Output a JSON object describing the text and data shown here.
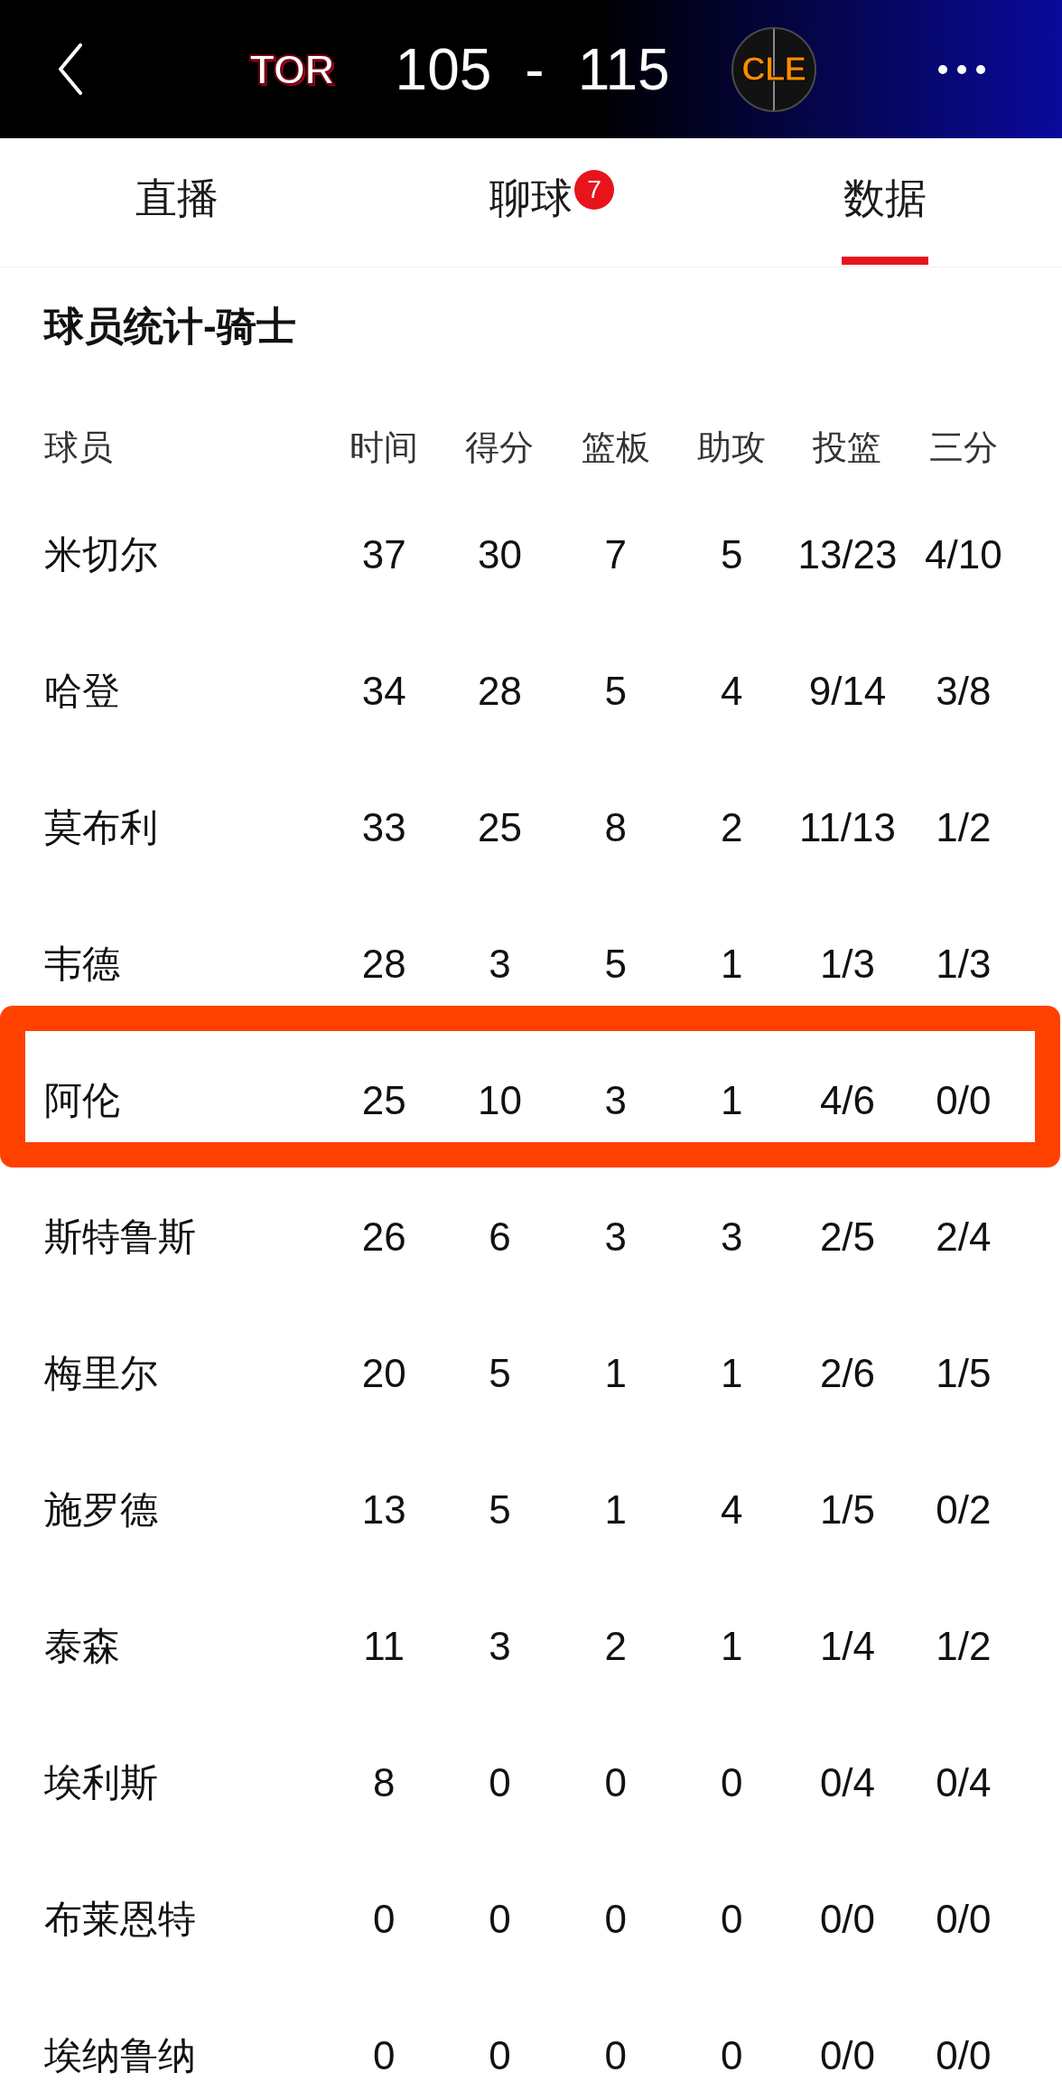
{
  "header": {
    "away_team": {
      "abbr": "TOR"
    },
    "score": "105 - 115",
    "home_team": {
      "abbr": "CLE"
    }
  },
  "tabs": [
    {
      "label": "直播",
      "selected": false
    },
    {
      "label": "聊球",
      "selected": false,
      "badge": "7"
    },
    {
      "label": "数据",
      "selected": true
    }
  ],
  "section_title": "球员统计-骑士",
  "table": {
    "columns": [
      "球员",
      "时间",
      "得分",
      "篮板",
      "助攻",
      "投篮",
      "三分"
    ],
    "rows": [
      {
        "cells": [
          "米切尔",
          "37",
          "30",
          "7",
          "5",
          "13/23",
          "4/10"
        ],
        "highlighted": false
      },
      {
        "cells": [
          "哈登",
          "34",
          "28",
          "5",
          "4",
          "9/14",
          "3/8"
        ],
        "highlighted": false
      },
      {
        "cells": [
          "莫布利",
          "33",
          "25",
          "8",
          "2",
          "11/13",
          "1/2"
        ],
        "highlighted": false
      },
      {
        "cells": [
          "韦德",
          "28",
          "3",
          "5",
          "1",
          "1/3",
          "1/3"
        ],
        "highlighted": false
      },
      {
        "cells": [
          "阿伦",
          "25",
          "10",
          "3",
          "1",
          "4/6",
          "0/0"
        ],
        "highlighted": true
      },
      {
        "cells": [
          "斯特鲁斯",
          "26",
          "6",
          "3",
          "3",
          "2/5",
          "2/4"
        ],
        "highlighted": false
      },
      {
        "cells": [
          "梅里尔",
          "20",
          "5",
          "1",
          "1",
          "2/6",
          "1/5"
        ],
        "highlighted": false
      },
      {
        "cells": [
          "施罗德",
          "13",
          "5",
          "1",
          "4",
          "1/5",
          "0/2"
        ],
        "highlighted": false
      },
      {
        "cells": [
          "泰森",
          "11",
          "3",
          "2",
          "1",
          "1/4",
          "1/2"
        ],
        "highlighted": false
      },
      {
        "cells": [
          "埃利斯",
          "8",
          "0",
          "0",
          "0",
          "0/4",
          "0/4"
        ],
        "highlighted": false
      },
      {
        "cells": [
          "布莱恩特",
          "0",
          "0",
          "0",
          "0",
          "0/0",
          "0/0"
        ],
        "highlighted": false
      },
      {
        "cells": [
          "埃纳鲁纳",
          "0",
          "0",
          "0",
          "0",
          "0/0",
          "0/0"
        ],
        "highlighted": false
      }
    ]
  }
}
